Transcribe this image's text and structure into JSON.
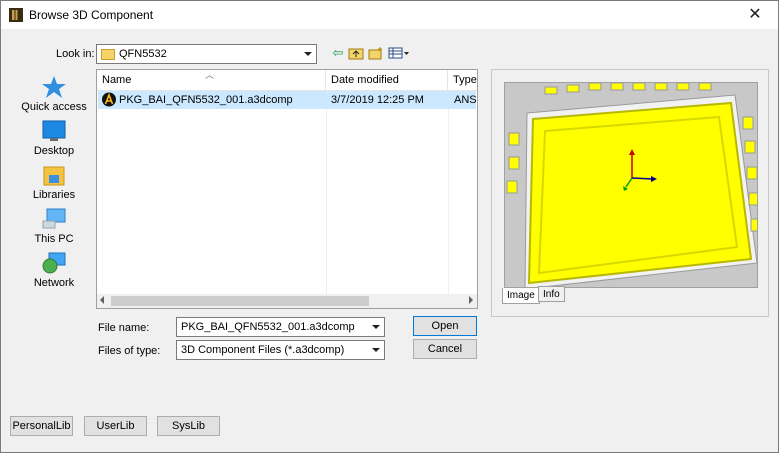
{
  "window": {
    "title": "Browse 3D Component",
    "close_glyph": "✕"
  },
  "look_in": {
    "label": "Look in:",
    "value": "QFN5532"
  },
  "places": [
    {
      "label": "Quick access",
      "icon": "quick-access-icon"
    },
    {
      "label": "Desktop",
      "icon": "desktop-icon"
    },
    {
      "label": "Libraries",
      "icon": "libraries-icon"
    },
    {
      "label": "This PC",
      "icon": "this-pc-icon"
    },
    {
      "label": "Network",
      "icon": "network-icon"
    }
  ],
  "columns": {
    "name": "Name",
    "date": "Date modified",
    "type": "Type"
  },
  "files": [
    {
      "name": "PKG_BAI_QFN5532_001.a3dcomp",
      "date": "3/7/2019 12:25 PM",
      "type": "ANSY"
    }
  ],
  "file_name": {
    "label": "File name:",
    "value": "PKG_BAI_QFN5532_001.a3dcomp"
  },
  "file_type": {
    "label": "Files of type:",
    "value": "3D Component Files (*.a3dcomp)"
  },
  "buttons": {
    "open": "Open",
    "cancel": "Cancel",
    "personal": "PersonalLib",
    "user": "UserLib",
    "sys": "SysLib"
  },
  "preview_tabs": {
    "image": "Image",
    "info": "Info"
  },
  "colors": {
    "selection": "#cce8ff",
    "component": "#ffff00",
    "accent": "#0078d7"
  }
}
